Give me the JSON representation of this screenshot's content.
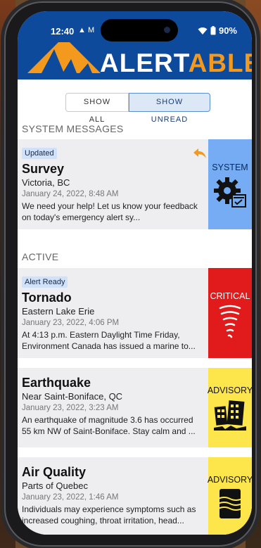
{
  "status_bar": {
    "time": "12:40",
    "indicators": "▲ M",
    "battery": "90%"
  },
  "header": {
    "logo_alert": "ALERT",
    "logo_able": "ABLE",
    "bg_color": "#0d4a9c",
    "accent_color": "#f39a1e"
  },
  "filter": {
    "show_all": "SHOW ALL",
    "show_unread": "SHOW UNREAD",
    "selected": "SHOW UNREAD"
  },
  "sections": {
    "system": "SYSTEM MESSAGES",
    "active": "ACTIVE"
  },
  "cards": [
    {
      "badge": "Updated",
      "title": "Survey",
      "location": "Victoria, BC",
      "date": "January 24, 2022, 8:48 AM",
      "message": "We need your help!  Let us know your feedback on today's emergency alert sy...",
      "level": "SYSTEM",
      "icon": "gear-icon",
      "color": "#75acf3"
    },
    {
      "badge": "Alert Ready",
      "title": "Tornado",
      "location": "Eastern Lake Erie",
      "date": "January 23, 2022, 4:06 PM",
      "message": "At 4:13 p.m. Eastern Daylight Time Friday, Environment Canada has issued a marine to...",
      "level": "CRITICAL",
      "icon": "tornado-icon",
      "color": "#e11b1b"
    },
    {
      "badge": "",
      "title": "Earthquake",
      "location": "Near Saint-Boniface, QC",
      "date": "January 23, 2022, 3:23 AM",
      "message": "An earthquake of magnitude 3.6 has occurred 55 km NW of Saint-Boniface. Stay calm and ...",
      "level": "ADVISORY",
      "icon": "earthquake-icon",
      "color": "#fce64b"
    },
    {
      "badge": "",
      "title": "Air Quality",
      "location": "Parts of Quebec",
      "date": "January 23, 2022, 1:46 AM",
      "message": "Individuals may experience symptoms such as increased coughing, throat irritation, head...",
      "level": "ADVISORY",
      "icon": "air-quality-icon",
      "color": "#fce64b"
    }
  ]
}
